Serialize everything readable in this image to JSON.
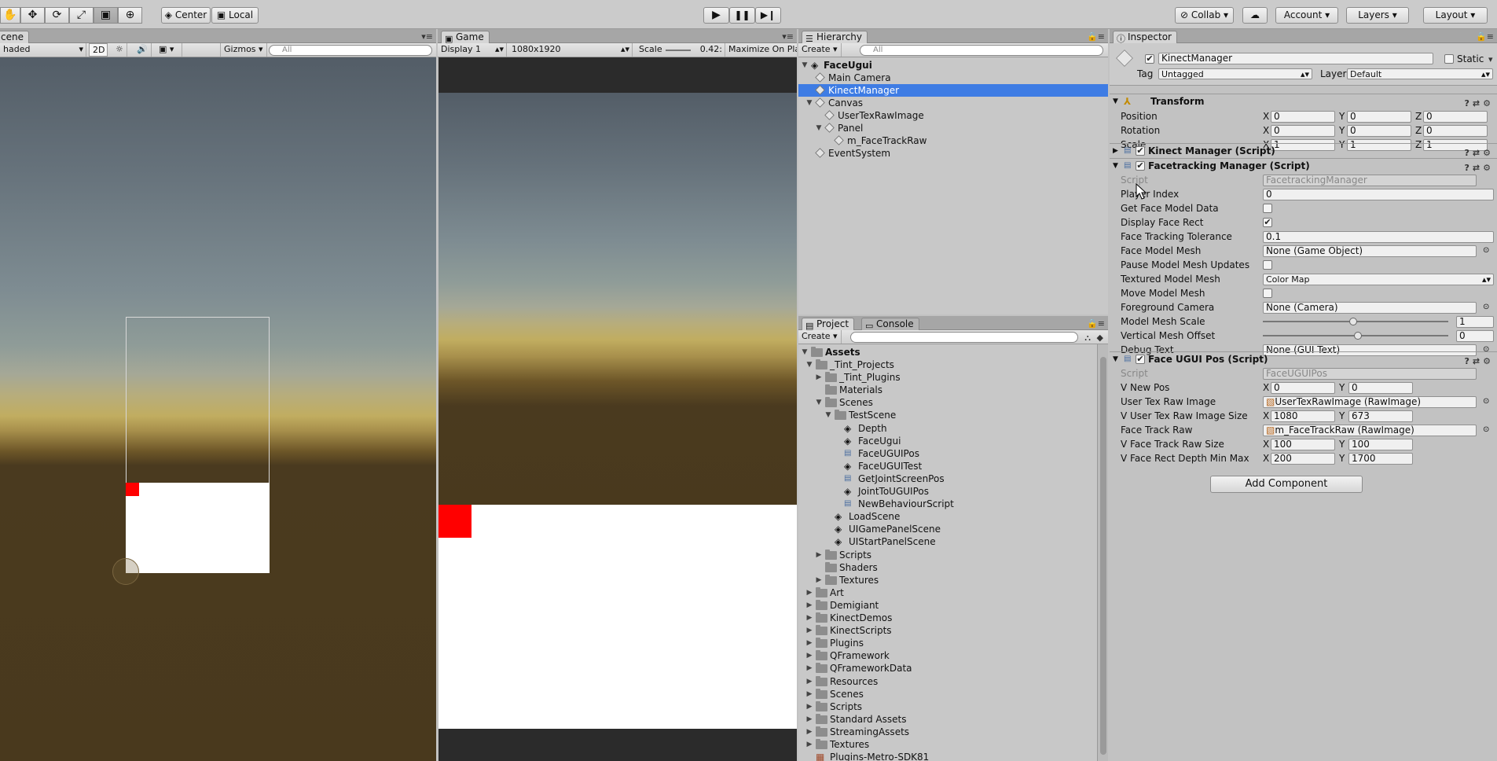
{
  "toolbar": {
    "tools": [
      "hand-icon",
      "move-icon",
      "rotate-icon",
      "scale-icon",
      "rect-tool-icon",
      "transform-tool-icon"
    ],
    "pivot": "Center",
    "space": "Local",
    "collab": "Collab",
    "account": "Account",
    "layers": "Layers",
    "layout": "Layout"
  },
  "scene": {
    "tab": "cene",
    "shading": "haded",
    "mode_2d": "2D",
    "gizmos": "Gizmos",
    "search_placeholder": "All"
  },
  "game": {
    "tab": "Game",
    "display": "Display 1",
    "resolution": "1080x1920",
    "scale_label": "Scale",
    "scale_value": "0.42:",
    "maximize": "Maximize On Play"
  },
  "hierarchy": {
    "tab": "Hierarchy",
    "create": "Create",
    "search_placeholder": "All",
    "scene_name": "FaceUgui",
    "items": [
      {
        "label": "Main Camera",
        "depth": 1,
        "arrow": ""
      },
      {
        "label": "KinectManager",
        "depth": 1,
        "arrow": "",
        "selected": true
      },
      {
        "label": "Canvas",
        "depth": 1,
        "arrow": "▼"
      },
      {
        "label": "UserTexRawImage",
        "depth": 2,
        "arrow": ""
      },
      {
        "label": "Panel",
        "depth": 2,
        "arrow": "▼"
      },
      {
        "label": "m_FaceTrackRaw",
        "depth": 3,
        "arrow": ""
      },
      {
        "label": "EventSystem",
        "depth": 1,
        "arrow": ""
      }
    ]
  },
  "project": {
    "tab_project": "Project",
    "tab_console": "Console",
    "create": "Create",
    "root": "Assets",
    "items": [
      {
        "label": "_Tint_Projects",
        "depth": 1,
        "arrow": "▼",
        "type": "folder"
      },
      {
        "label": "_Tint_Plugins",
        "depth": 2,
        "arrow": "▶",
        "type": "folder"
      },
      {
        "label": "Materials",
        "depth": 2,
        "arrow": "",
        "type": "folder"
      },
      {
        "label": "Scenes",
        "depth": 2,
        "arrow": "▼",
        "type": "folder"
      },
      {
        "label": "TestScene",
        "depth": 3,
        "arrow": "▼",
        "type": "folder"
      },
      {
        "label": "Depth",
        "depth": 4,
        "arrow": "",
        "type": "scene"
      },
      {
        "label": "FaceUgui",
        "depth": 4,
        "arrow": "",
        "type": "scene"
      },
      {
        "label": "FaceUGUIPos",
        "depth": 4,
        "arrow": "",
        "type": "script"
      },
      {
        "label": "FaceUGUITest",
        "depth": 4,
        "arrow": "",
        "type": "scene"
      },
      {
        "label": "GetJointScreenPos",
        "depth": 4,
        "arrow": "",
        "type": "script"
      },
      {
        "label": "JointToUGUIPos",
        "depth": 4,
        "arrow": "",
        "type": "scene"
      },
      {
        "label": "NewBehaviourScript",
        "depth": 4,
        "arrow": "",
        "type": "script"
      },
      {
        "label": "LoadScene",
        "depth": 3,
        "arrow": "",
        "type": "scene"
      },
      {
        "label": "UIGamePanelScene",
        "depth": 3,
        "arrow": "",
        "type": "scene"
      },
      {
        "label": "UIStartPanelScene",
        "depth": 3,
        "arrow": "",
        "type": "scene"
      },
      {
        "label": "Scripts",
        "depth": 2,
        "arrow": "▶",
        "type": "folder"
      },
      {
        "label": "Shaders",
        "depth": 2,
        "arrow": "",
        "type": "folder"
      },
      {
        "label": "Textures",
        "depth": 2,
        "arrow": "▶",
        "type": "folder"
      },
      {
        "label": "Art",
        "depth": 1,
        "arrow": "▶",
        "type": "folder"
      },
      {
        "label": "Demigiant",
        "depth": 1,
        "arrow": "▶",
        "type": "folder"
      },
      {
        "label": "KinectDemos",
        "depth": 1,
        "arrow": "▶",
        "type": "folder"
      },
      {
        "label": "KinectScripts",
        "depth": 1,
        "arrow": "▶",
        "type": "folder"
      },
      {
        "label": "Plugins",
        "depth": 1,
        "arrow": "▶",
        "type": "folder"
      },
      {
        "label": "QFramework",
        "depth": 1,
        "arrow": "▶",
        "type": "folder"
      },
      {
        "label": "QFrameworkData",
        "depth": 1,
        "arrow": "▶",
        "type": "folder"
      },
      {
        "label": "Resources",
        "depth": 1,
        "arrow": "▶",
        "type": "folder"
      },
      {
        "label": "Scenes",
        "depth": 1,
        "arrow": "▶",
        "type": "folder"
      },
      {
        "label": "Scripts",
        "depth": 1,
        "arrow": "▶",
        "type": "folder"
      },
      {
        "label": "Standard Assets",
        "depth": 1,
        "arrow": "▶",
        "type": "folder"
      },
      {
        "label": "StreamingAssets",
        "depth": 1,
        "arrow": "▶",
        "type": "folder"
      },
      {
        "label": "Textures",
        "depth": 1,
        "arrow": "▶",
        "type": "folder"
      },
      {
        "label": "Plugins-Metro-SDK81",
        "depth": 1,
        "arrow": "",
        "type": "package"
      }
    ]
  },
  "inspector": {
    "tab": "Inspector",
    "object_name": "KinectManager",
    "static_label": "Static",
    "tag_label": "Tag",
    "tag_value": "Untagged",
    "layer_label": "Layer",
    "layer_value": "Default",
    "transform": {
      "title": "Transform",
      "rows": [
        {
          "label": "Position",
          "x": "0",
          "y": "0",
          "z": "0"
        },
        {
          "label": "Rotation",
          "x": "0",
          "y": "0",
          "z": "0"
        },
        {
          "label": "Scale",
          "x": "1",
          "y": "1",
          "z": "1"
        }
      ]
    },
    "kinect_manager": {
      "title": "Kinect Manager (Script)"
    },
    "facetracking": {
      "title": "Facetracking Manager (Script)",
      "script_label": "Script",
      "script_value": "FacetrackingManager",
      "player_index_label": "Player Index",
      "player_index": "0",
      "get_face_model_data": "Get Face Model Data",
      "display_face_rect": "Display Face Rect",
      "tolerance_label": "Face Tracking Tolerance",
      "tolerance": "0.1",
      "face_model_mesh_label": "Face Model Mesh",
      "face_model_mesh": "None (Game Object)",
      "pause_label": "Pause Model Mesh Updates",
      "textured_label": "Textured Model Mesh",
      "textured_value": "Color Map",
      "move_label": "Move Model Mesh",
      "fg_camera_label": "Foreground Camera",
      "fg_camera": "None (Camera)",
      "mesh_scale_label": "Model Mesh Scale",
      "mesh_scale": "1",
      "mesh_offset_label": "Vertical Mesh Offset",
      "mesh_offset": "0",
      "debug_label": "Debug Text",
      "debug_value": "None (GUI Text)"
    },
    "faceugui": {
      "title": "Face UGUI Pos (Script)",
      "script_label": "Script",
      "script_value": "FaceUGUIPos",
      "newpos_label": "V New Pos",
      "newpos_x": "0",
      "newpos_y": "0",
      "usertex_label": "User Tex Raw Image",
      "usertex_value": "UserTexRawImage (RawImage)",
      "usertex_size_label": "V User Tex Raw Image Size",
      "usertex_size_x": "1080",
      "usertex_size_y": "673",
      "facetrack_label": "Face Track Raw",
      "facetrack_value": "m_FaceTrackRaw (RawImage)",
      "facetrack_size_label": "V Face Track Raw Size",
      "facetrack_size_x": "100",
      "facetrack_size_y": "100",
      "depth_label": "V Face Rect Depth Min Max",
      "depth_x": "200",
      "depth_y": "1700"
    },
    "add_component": "Add Component",
    "axes": {
      "x": "X",
      "y": "Y",
      "z": "Z"
    }
  }
}
